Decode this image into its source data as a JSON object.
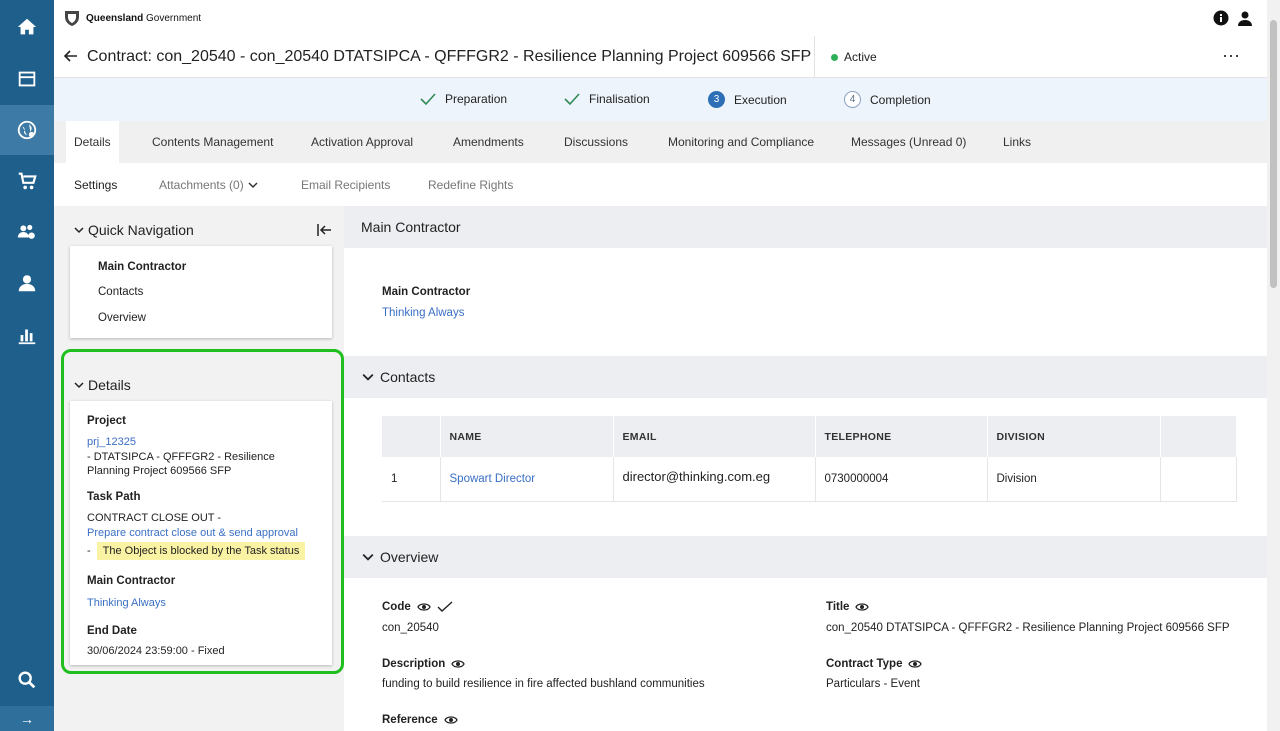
{
  "brand": {
    "name_bold": "Queensland",
    "name_rest": " Government"
  },
  "header": {
    "title": "Contract: con_20540 - con_20540 DTATSIPCA - QFFFGR2 - Resilience Planning Project 609566 SFP",
    "status": "Active",
    "status_color": "#2eaf5a",
    "more": "⋯"
  },
  "stepper": [
    {
      "label": "Preparation",
      "state": "done"
    },
    {
      "label": "Finalisation",
      "state": "done"
    },
    {
      "label": "Execution",
      "number": "3",
      "state": "current"
    },
    {
      "label": "Completion",
      "number": "4",
      "state": "future"
    }
  ],
  "tabs": [
    "Details",
    "Contents Management",
    "Activation Approval",
    "Amendments",
    "Discussions",
    "Monitoring and Compliance",
    "Messages (Unread 0)",
    "Links"
  ],
  "subtabs": [
    "Settings",
    "Attachments (0)",
    "Email Recipients",
    "Redefine Rights"
  ],
  "quick_nav": {
    "title": "Quick Navigation",
    "items": [
      "Main Contractor",
      "Contacts",
      "Overview"
    ]
  },
  "details_panel": {
    "title": "Details",
    "project_label": "Project",
    "project_link": "prj_12325",
    "project_desc": "- DTATSIPCA - QFFFGR2 - Resilience Planning Project 609566 SFP",
    "task_path_label": "Task Path",
    "task_path_text": "CONTRACT CLOSE OUT -",
    "task_path_link": "Prepare contract close out & send approval",
    "warn_dash": "-",
    "warn_text": "The Object is blocked by the Task status",
    "main_contractor_label": "Main Contractor",
    "main_contractor_link": "Thinking Always",
    "end_date_label": "End Date",
    "end_date_value": "30/06/2024 23:59:00 - Fixed"
  },
  "main_contractor": {
    "section_title": "Main Contractor",
    "label": "Main Contractor",
    "value": "Thinking Always"
  },
  "contacts": {
    "section_title": "Contacts",
    "columns": [
      "",
      "NAME",
      "EMAIL",
      "TELEPHONE",
      "DIVISION",
      ""
    ],
    "rows": [
      {
        "index": "1",
        "name": "Spowart Director",
        "email": "director@thinking.com.eg",
        "telephone": "0730000004",
        "division": "Division"
      }
    ]
  },
  "overview": {
    "section_title": "Overview",
    "code_label": "Code",
    "code_value": "con_20540",
    "title_label": "Title",
    "title_value": "con_20540 DTATSIPCA - QFFFGR2 - Resilience Planning Project 609566 SFP",
    "description_label": "Description",
    "description_value": "funding to build resilience in fire affected bushland communities",
    "contract_type_label": "Contract Type",
    "contract_type_value": "Particulars - Event",
    "reference_label": "Reference"
  },
  "rail_bottom_glyph": "→"
}
